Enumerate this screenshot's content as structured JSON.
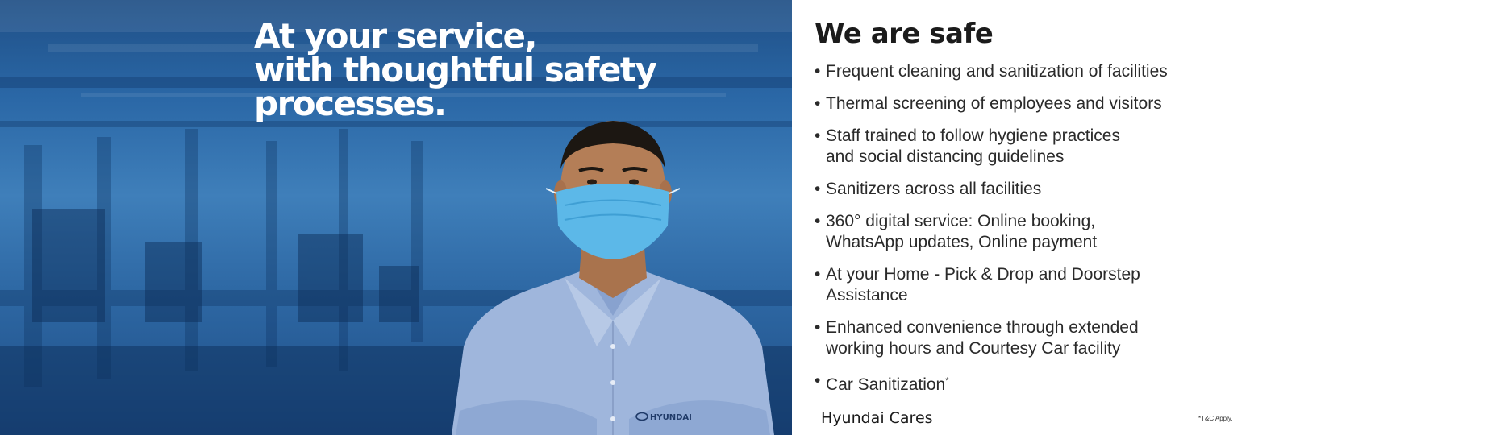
{
  "hero": {
    "headline_lines": [
      "At your service,",
      "with thoughtful safety",
      "processes."
    ],
    "shirt_logo_text": "HYUNDAI"
  },
  "safety": {
    "title": "We are safe",
    "bullet": "•",
    "items": [
      {
        "lines": [
          "Frequent cleaning and sanitization of facilities"
        ]
      },
      {
        "lines": [
          "Thermal screening of employees and visitors"
        ]
      },
      {
        "lines": [
          "Staff trained to follow hygiene practices",
          "and social distancing guidelines"
        ]
      },
      {
        "lines": [
          "Sanitizers across all facilities"
        ]
      },
      {
        "lines": [
          "360° digital service: Online booking,",
          "WhatsApp updates, Online payment"
        ]
      },
      {
        "lines": [
          "At your Home - Pick & Drop and Doorstep",
          "Assistance"
        ]
      },
      {
        "lines": [
          "Enhanced convenience through extended",
          "working hours and Courtesy Car facility"
        ]
      },
      {
        "lines": [
          "Car Sanitization"
        ],
        "sup": "*"
      }
    ]
  },
  "footer": {
    "brand": "Hyundai Cares",
    "disclaimer": "*T&C Apply."
  },
  "colors": {
    "photo_blue": "#2a67a6",
    "mask_blue": "#5cb8e8",
    "shirt_blue": "#9fb6dc",
    "text_dark": "#1b1b1b"
  }
}
